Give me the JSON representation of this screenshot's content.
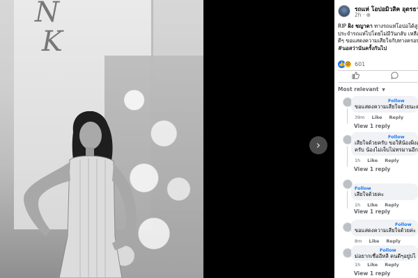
{
  "photo": {
    "monogram_top": "N",
    "monogram_bottom": "K"
  },
  "viewer": {
    "next_icon": "chevron-right-icon",
    "next_glyph": "›"
  },
  "post": {
    "page_name": "รถแห่ โอปอมิวสิค อุดรธานี",
    "time": "2h",
    "privacy_icon": "globe-icon",
    "lines": [
      [
        "RIP ",
        "ผิง ชญาดา",
        " ทางรถแห่โอปอได้สูญเ"
      ],
      [
        "ประจำรถแห่ไปโดยไม่มีวันกลับ เหลือไว้"
      ],
      [
        "ดีๆ ขอแสดงความเสียใจกับทางครอบค"
      ],
      [
        "#นอสว่านันครั้งกันไป"
      ]
    ],
    "reaction_count": "601",
    "reaction_icons": [
      "like-reaction-icon",
      "sad-reaction-icon"
    ]
  },
  "actions": {
    "like_icon": "thumbs-up-icon",
    "comment_icon": "comment-icon"
  },
  "sort_label": "Most relevant",
  "comments": [
    {
      "follow": "Follow",
      "text": "ขอแสดงความเสียใจด้วยนะคะ",
      "time": "39m",
      "like": "Like",
      "reply": "Reply",
      "view_replies": "View 1 reply"
    },
    {
      "follow": "Follow",
      "text": "เสียใจด้วยครับ ขอให้น้องผิงสู่สุ",
      "text2": "ครับ น้องไม่เจ็บไม่ทรมานอีกแล",
      "time": "1h",
      "like": "Like",
      "reply": "Reply",
      "view_replies": "View 1 reply"
    },
    {
      "follow": "Follow",
      "text": "เสียใจด้วยคะ",
      "time": "1h",
      "like": "Like",
      "reply": "Reply",
      "view_replies": "View 1 reply"
    },
    {
      "follow": "Follow",
      "text": "ขอแสดงความเสียใจด้วยค่ะ",
      "time": "8m",
      "like": "Like",
      "reply": "Reply"
    },
    {
      "follow": "Follow",
      "text": "ม่อยากเชื่ออีหลี คนดีๆอยู่บ่ไ",
      "time": "1h",
      "like": "Like",
      "reply": "Reply",
      "view_replies": "View 1 reply"
    }
  ]
}
